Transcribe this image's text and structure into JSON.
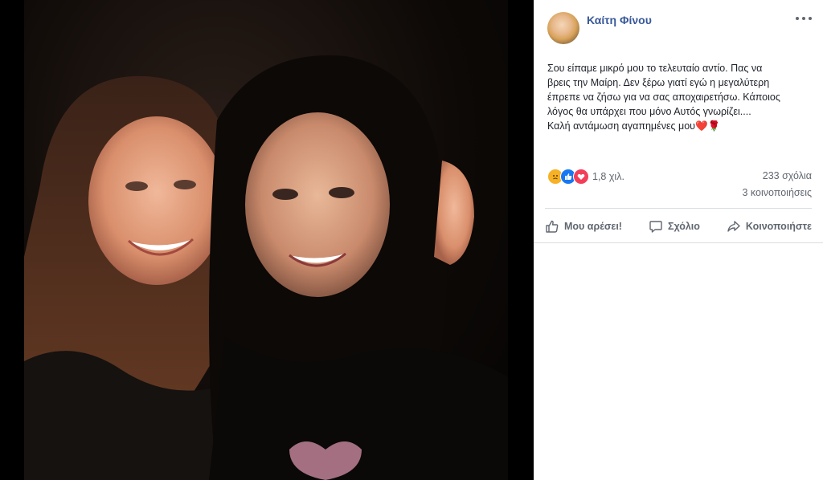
{
  "post": {
    "author": "Καίτη Φίνου",
    "text_lines": [
      "Σου είπαμε μικρό μου το τελευταίο αντίο. Πας να",
      "βρεις την Μαίρη. Δεν ξέρω γιατί εγώ η μεγαλύτερη",
      "έπρεπε να ζήσω για να σας αποχαιρετήσω. Κάποιος",
      "λόγος θα υπάρχει που μόνο Αυτός γνωρίζει....",
      "Καλή αντάμωση αγαπημένες μου❤️🌹"
    ],
    "reactions_count": "1,8 χιλ.",
    "reaction_icons": [
      "sad-emoji-icon",
      "like-icon",
      "love-icon"
    ],
    "comments_count": "233 σχόλια",
    "shares_count": "3 κοινοποιήσεις"
  },
  "actions": {
    "like": "Μου αρέσει!",
    "comment": "Σχόλιο",
    "share": "Κοινοποιήστε"
  },
  "colors": {
    "author": "#385898",
    "text": "#1d2129",
    "muted": "#606770",
    "like": "#1877f2",
    "love": "#f33e58",
    "sad": "#f7b125"
  }
}
